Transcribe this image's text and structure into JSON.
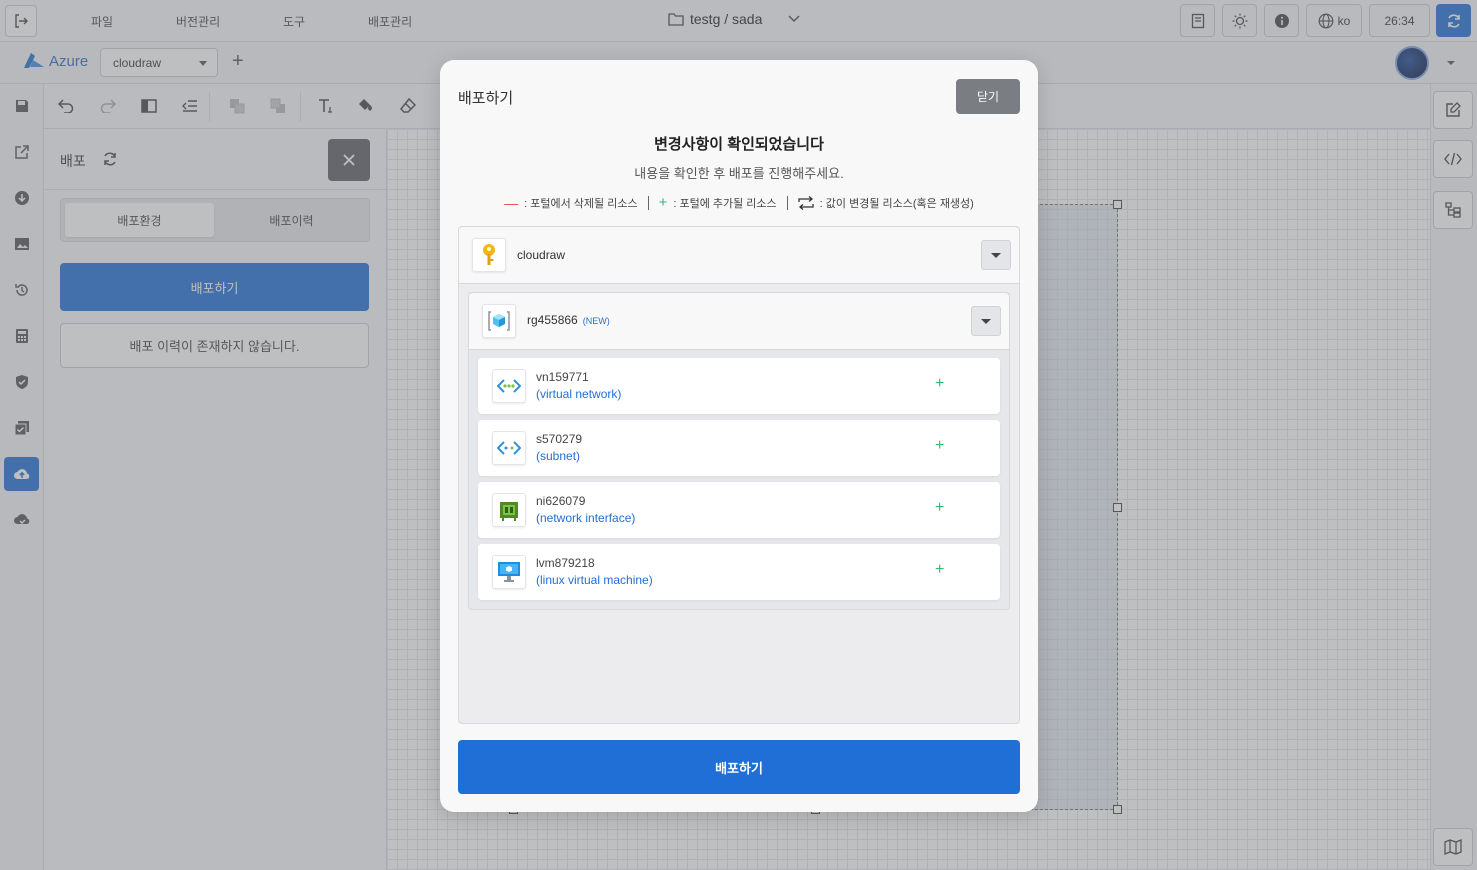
{
  "topbar": {
    "menu": [
      "파일",
      "버전관리",
      "도구",
      "배포관리"
    ],
    "project_path": "testg / sada",
    "language": "ko",
    "timer": "26:34"
  },
  "secondbar": {
    "cloud_provider": "Azure",
    "environment": "cloudraw",
    "add_label": "+"
  },
  "panel": {
    "title": "배포",
    "tabs": [
      "배포환경",
      "배포이력"
    ],
    "active_tab": "배포환경",
    "deploy_button": "배포하기",
    "empty_message": "배포 이력이 존재하지 않습니다."
  },
  "modal": {
    "title": "배포하기",
    "close_label": "닫기",
    "heading": "변경사항이 확인되었습니다",
    "subheading": "내용을 확인한 후 배포를 진행해주세요.",
    "legend": {
      "delete_symbol": "—",
      "delete_text": ": 포털에서 삭제될 리소스",
      "add_symbol": "+",
      "add_text": ": 포털에 추가될 리소스",
      "change_text": ": 값이 변경될 리소스(혹은 재생성)"
    },
    "subscription": "cloudraw",
    "resource_group": {
      "name": "rg455866",
      "tag": "(NEW)"
    },
    "resources": [
      {
        "name": "vn159771",
        "type": "(virtual network)",
        "icon": "virtual-network-icon",
        "change": "+"
      },
      {
        "name": "s570279",
        "type": "(subnet)",
        "icon": "subnet-icon",
        "change": "+"
      },
      {
        "name": "ni626079",
        "type": "(network interface)",
        "icon": "network-interface-icon",
        "change": "+"
      },
      {
        "name": "lvm879218",
        "type": "(linux virtual machine)",
        "icon": "virtual-machine-icon",
        "change": "+"
      }
    ],
    "deploy_button": "배포하기"
  },
  "colors": {
    "primary": "#1f6fd6",
    "add": "#2fba76",
    "delete": "#e04848"
  }
}
